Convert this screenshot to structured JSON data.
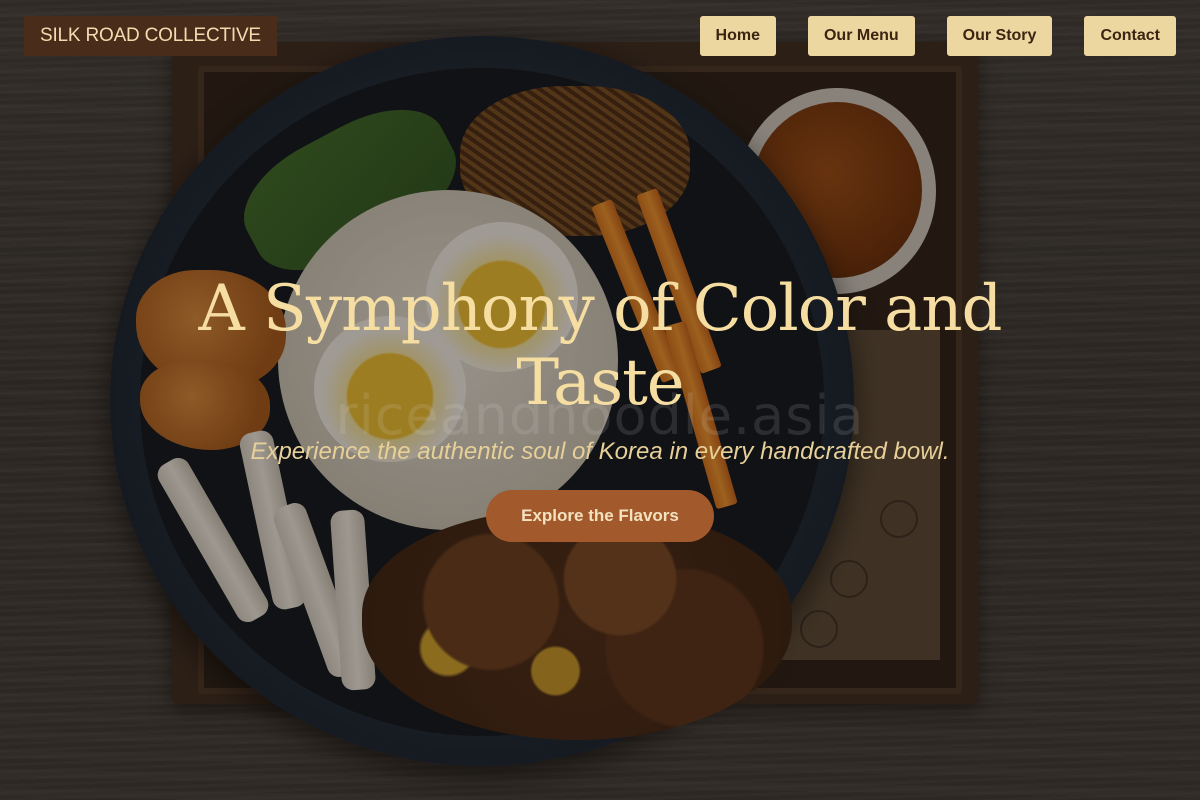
{
  "brand": {
    "name": "SILK ROAD COLLECTIVE"
  },
  "nav": {
    "items": [
      {
        "label": "Home"
      },
      {
        "label": "Our Menu"
      },
      {
        "label": "Our Story"
      },
      {
        "label": "Contact"
      }
    ]
  },
  "hero": {
    "title": "A Symphony of Color and Taste",
    "tagline": "Experience the authentic soul of Korea in every handcrafted bowl.",
    "cta_label": "Explore the Flavors",
    "watermark": "riceandnoodle.asia",
    "background_image": "korean-rice-bowl-photo"
  },
  "colors": {
    "accent": "#a25a2c",
    "nav_button_bg": "#edd7a0",
    "brand_bg": "#4a2c1a",
    "title": "#f6dea2"
  }
}
